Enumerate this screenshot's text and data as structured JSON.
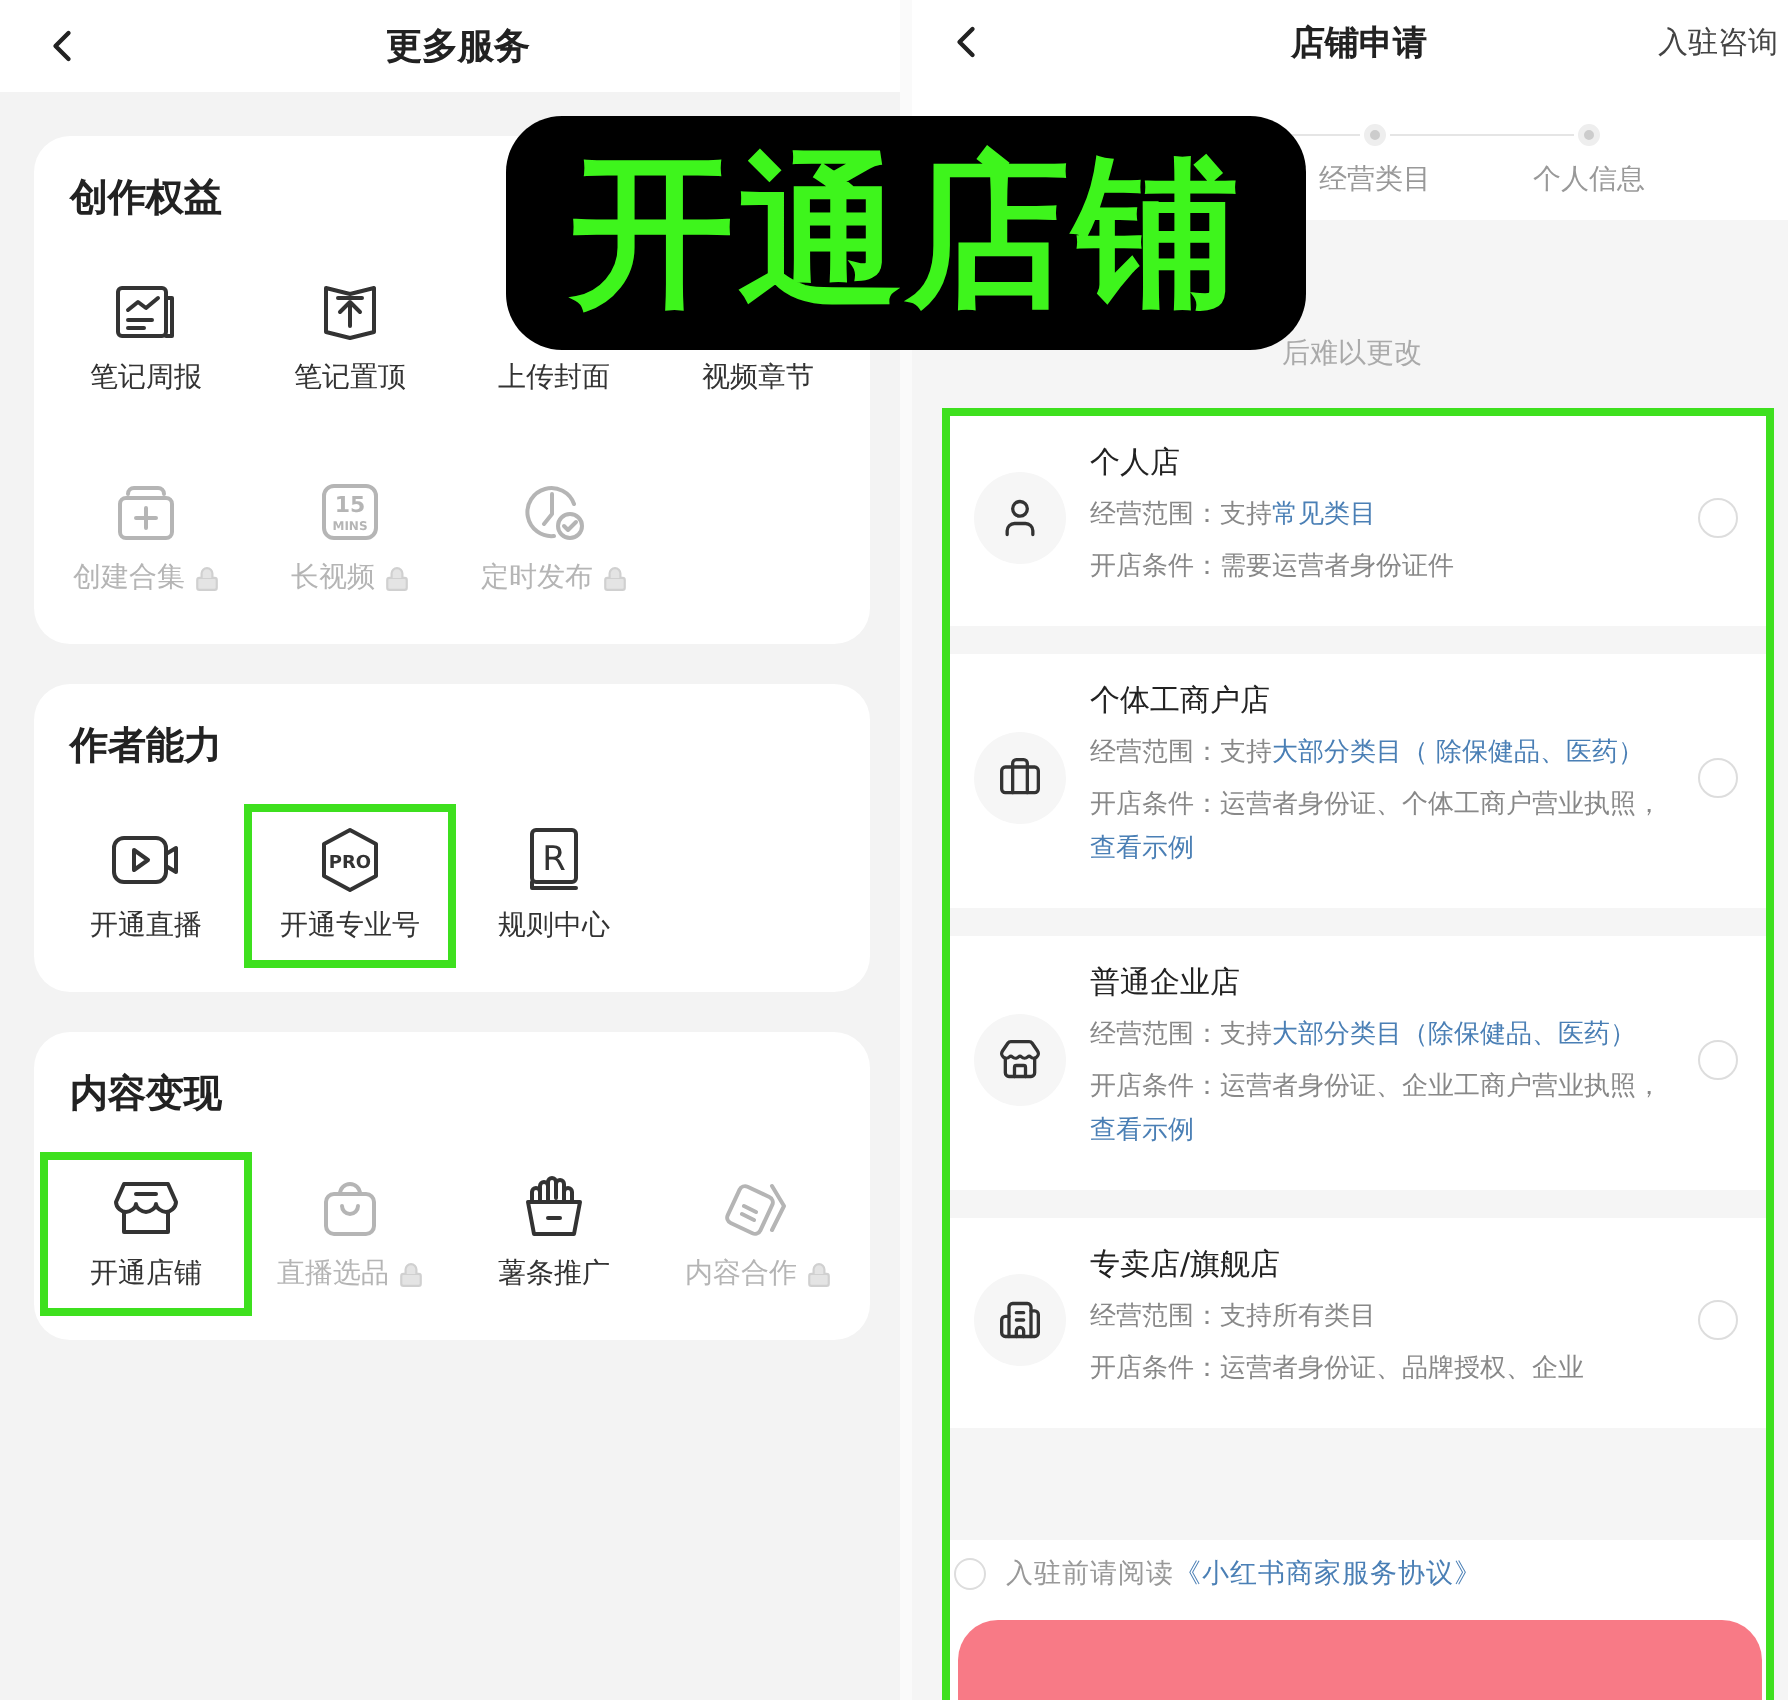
{
  "banner": {
    "text": "开通店铺"
  },
  "left": {
    "title": "更多服务",
    "sections": [
      {
        "title": "创作权益",
        "items": [
          {
            "label": "笔记周报",
            "kind": "report",
            "locked": false,
            "highlighted": false
          },
          {
            "label": "笔记置顶",
            "kind": "pin",
            "locked": false,
            "highlighted": false
          },
          {
            "label": "上传封面",
            "locked": false,
            "highlighted": false
          },
          {
            "label": "视频章节",
            "locked": false,
            "highlighted": false
          },
          {
            "label": "创建合集",
            "kind": "add",
            "locked": true,
            "highlighted": false
          },
          {
            "label": "长视频",
            "kind": "timer",
            "icon_text": [
              "15",
              "MINS"
            ],
            "locked": true,
            "highlighted": false
          },
          {
            "label": "定时发布",
            "kind": "clock",
            "locked": true,
            "highlighted": false
          }
        ]
      },
      {
        "title": "作者能力",
        "items": [
          {
            "label": "开通直播",
            "kind": "video",
            "locked": false,
            "highlighted": false
          },
          {
            "label": "开通专业号",
            "kind": "pro",
            "icon_text": [
              "PRO"
            ],
            "locked": false,
            "highlighted": true
          },
          {
            "label": "规则中心",
            "kind": "rule",
            "icon_text": [
              "R"
            ],
            "locked": false,
            "highlighted": false
          }
        ]
      },
      {
        "title": "内容变现",
        "items": [
          {
            "label": "开通店铺",
            "kind": "store",
            "locked": false,
            "highlighted": true
          },
          {
            "label": "直播选品",
            "kind": "bag",
            "locked": true,
            "highlighted": false
          },
          {
            "label": "薯条推广",
            "kind": "fries",
            "locked": false,
            "highlighted": false
          },
          {
            "label": "内容合作",
            "kind": "cards",
            "locked": true,
            "highlighted": false
          }
        ]
      }
    ]
  },
  "right": {
    "title": "店铺申请",
    "action": "入驻咨询",
    "steps": [
      {
        "label": "经营类目"
      },
      {
        "label": "个人信息"
      }
    ],
    "notice": "后难以更改",
    "highlighted": true,
    "shops": [
      {
        "name": "个人店",
        "kind": "person",
        "selected": false,
        "scope_label": "经营范围：支持",
        "scope_link": "常见类目",
        "condition": "开店条件：需要运营者身份证件"
      },
      {
        "name": "个体工商户店",
        "kind": "briefcase",
        "selected": false,
        "scope_label": "经营范围：支持",
        "scope_link": "大部分类目（ 除保健品、医药）",
        "condition": "开店条件：运营者身份证、个体工商户营业执照，",
        "condition_link": "查看示例"
      },
      {
        "name": "普通企业店",
        "kind": "store",
        "selected": false,
        "scope_label": "经营范围：支持",
        "scope_link": "大部分类目（除保健品、医药）",
        "condition": "开店条件：运营者身份证、企业工商户营业执照，",
        "condition_link": "查看示例"
      },
      {
        "name": "专卖店/旗舰店",
        "kind": "building",
        "selected": false,
        "scope_label": "经营范围：支持所有类目",
        "condition": "开店条件：运营者身份证、品牌授权、企业"
      }
    ],
    "agreement": {
      "checked": false,
      "text": "入驻前请阅读",
      "link": "《小红书商家服务协议》"
    }
  }
}
